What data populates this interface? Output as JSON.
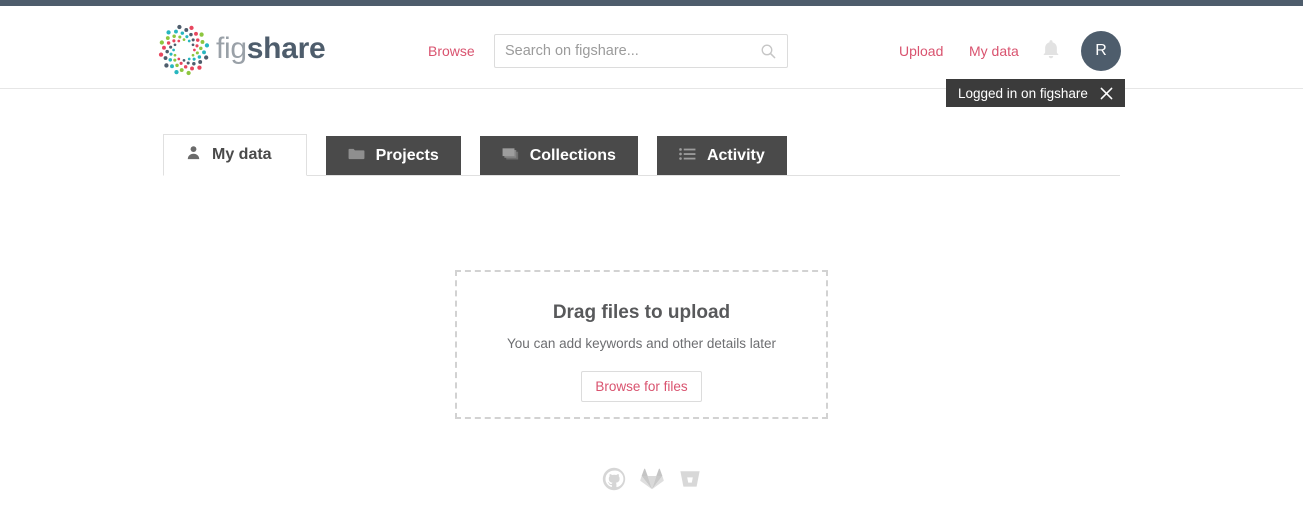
{
  "theme": {
    "accent_red": "#d9536f",
    "slate": "#4e5d6c",
    "tab_dark": "#4a4a4a",
    "tooltip_bg": "#3b3b3b",
    "logo_dot_colors": [
      "#e8465e",
      "#8dc63f",
      "#27b6bf",
      "#4e5d6c"
    ]
  },
  "header": {
    "logo": {
      "mark_name": "figshare-pinwheel-logo",
      "text_light": "fig",
      "text_bold": "share"
    },
    "browse_label": "Browse",
    "search": {
      "value": "",
      "placeholder": "Search on figshare...",
      "icon_name": "search-icon"
    },
    "upload_label": "Upload",
    "my_data_label": "My data",
    "bell_icon_name": "notification-bell-icon",
    "avatar_initial": "R"
  },
  "tooltip": {
    "message": "Logged in on figshare",
    "close_icon_name": "close-icon"
  },
  "tabs": [
    {
      "label": "My data",
      "icon": "user-icon",
      "active": true
    },
    {
      "label": "Projects",
      "icon": "folder-icon",
      "active": false
    },
    {
      "label": "Collections",
      "icon": "layers-icon",
      "active": false
    },
    {
      "label": "Activity",
      "icon": "list-icon",
      "active": false
    }
  ],
  "dropzone": {
    "title": "Drag files to upload",
    "subtitle": "You can add keywords and other details later",
    "button_label": "Browse for files"
  },
  "footer_icons": [
    {
      "name": "github-icon",
      "label": "GitHub"
    },
    {
      "name": "gitlab-icon",
      "label": "GitLab"
    },
    {
      "name": "bitbucket-icon",
      "label": "Bitbucket"
    }
  ]
}
